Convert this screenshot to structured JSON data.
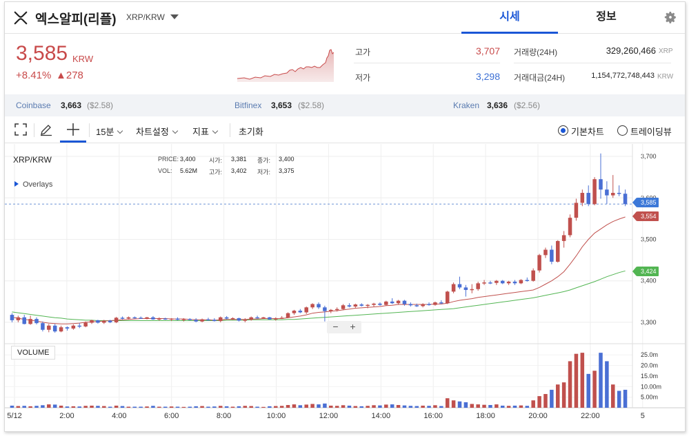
{
  "header": {
    "coin_name": "엑스알피(리플)",
    "pair": "XRP/KRW",
    "tabs": [
      {
        "label": "시세",
        "active": true
      },
      {
        "label": "정보",
        "active": false
      }
    ]
  },
  "summary": {
    "price": "3,585",
    "unit": "KRW",
    "change_pct": "+8.41%",
    "change_abs": "▲278",
    "high_label": "고가",
    "high_value": "3,707",
    "low_label": "저가",
    "low_value": "3,298",
    "volume_label": "거래량(24H)",
    "volume_value": "329,260,466",
    "volume_unit": "XRP",
    "amount_label": "거래대금(24H)",
    "amount_value": "1,154,772,748,443",
    "amount_unit": "KRW"
  },
  "exchanges": [
    {
      "name": "Coinbase",
      "price": "3,663",
      "usd": "($2.58)"
    },
    {
      "name": "Bitfinex",
      "price": "3,653",
      "usd": "($2.58)"
    },
    {
      "name": "Kraken",
      "price": "3,636",
      "usd": "($2.56)"
    }
  ],
  "toolbar": {
    "interval": "15분",
    "chart_settings": "차트설정",
    "indicators": "지표",
    "reset": "초기화",
    "mode_basic": "기본차트",
    "mode_trading": "트레이딩뷰"
  },
  "chart": {
    "pair_label": "XRP/KRW",
    "overlays_label": "Overlays",
    "volume_label": "VOLUME",
    "ohlc": {
      "price_label": "PRICE:",
      "price": "3,400",
      "open_label": "시가:",
      "open": "3,381",
      "close_label": "종가:",
      "close": "3,400",
      "vol_label": "VOL:",
      "vol": "5.62M",
      "high_label": "고가:",
      "high": "3,402",
      "low_label": "저가:",
      "low": "3,375"
    },
    "zoom_out": "−",
    "zoom_in": "+",
    "tags": {
      "current": "3,585",
      "ma_short": "3,554",
      "ma_long": "3,424"
    }
  },
  "chart_data": {
    "type": "candlestick",
    "x_tick_labels": [
      "5/12",
      "2:00",
      "4:00",
      "6:00",
      "8:00",
      "10:00",
      "12:00",
      "14:00",
      "16:00",
      "18:00",
      "20:00",
      "22:00",
      "5"
    ],
    "y_tick_labels": [
      "3,700",
      "3,600",
      "3,500",
      "3,400",
      "3,300"
    ],
    "ylim": [
      3270,
      3710
    ],
    "volume_tick_labels": [
      "25.0m",
      "20.0m",
      "15.0m",
      "10.00m",
      "5.00m"
    ],
    "volume_ylim": [
      0,
      28
    ],
    "grid": true,
    "current_price": 3585,
    "colors": {
      "up": "#c0504d",
      "down": "#4a6fd4",
      "ma_short": "#c0504d",
      "ma_long": "#52b552"
    },
    "candles": [
      {
        "o": 3318,
        "h": 3322,
        "l": 3300,
        "c": 3305,
        "v": 1.0
      },
      {
        "o": 3305,
        "h": 3316,
        "l": 3300,
        "c": 3312,
        "v": 0.8
      },
      {
        "o": 3312,
        "h": 3318,
        "l": 3295,
        "c": 3296,
        "v": 0.9
      },
      {
        "o": 3296,
        "h": 3316,
        "l": 3294,
        "c": 3308,
        "v": 0.7
      },
      {
        "o": 3308,
        "h": 3312,
        "l": 3295,
        "c": 3298,
        "v": 0.9
      },
      {
        "o": 3298,
        "h": 3302,
        "l": 3278,
        "c": 3282,
        "v": 1.2
      },
      {
        "o": 3282,
        "h": 3296,
        "l": 3276,
        "c": 3292,
        "v": 1.6
      },
      {
        "o": 3292,
        "h": 3296,
        "l": 3275,
        "c": 3278,
        "v": 1.5
      },
      {
        "o": 3278,
        "h": 3292,
        "l": 3276,
        "c": 3288,
        "v": 1.0
      },
      {
        "o": 3288,
        "h": 3290,
        "l": 3280,
        "c": 3285,
        "v": 0.6
      },
      {
        "o": 3285,
        "h": 3295,
        "l": 3282,
        "c": 3292,
        "v": 0.7
      },
      {
        "o": 3292,
        "h": 3298,
        "l": 3286,
        "c": 3290,
        "v": 0.6
      },
      {
        "o": 3290,
        "h": 3302,
        "l": 3288,
        "c": 3299,
        "v": 0.9
      },
      {
        "o": 3299,
        "h": 3306,
        "l": 3296,
        "c": 3305,
        "v": 1.0
      },
      {
        "o": 3305,
        "h": 3306,
        "l": 3297,
        "c": 3299,
        "v": 0.9
      },
      {
        "o": 3299,
        "h": 3306,
        "l": 3296,
        "c": 3304,
        "v": 0.8
      },
      {
        "o": 3304,
        "h": 3306,
        "l": 3298,
        "c": 3300,
        "v": 0.5
      },
      {
        "o": 3300,
        "h": 3313,
        "l": 3298,
        "c": 3311,
        "v": 1.0
      },
      {
        "o": 3311,
        "h": 3314,
        "l": 3307,
        "c": 3309,
        "v": 0.8
      },
      {
        "o": 3309,
        "h": 3314,
        "l": 3307,
        "c": 3312,
        "v": 0.5
      },
      {
        "o": 3312,
        "h": 3314,
        "l": 3309,
        "c": 3311,
        "v": 0.5
      },
      {
        "o": 3311,
        "h": 3314,
        "l": 3309,
        "c": 3310,
        "v": 0.5
      },
      {
        "o": 3310,
        "h": 3313,
        "l": 3307,
        "c": 3312,
        "v": 0.6
      },
      {
        "o": 3312,
        "h": 3315,
        "l": 3306,
        "c": 3307,
        "v": 0.9
      },
      {
        "o": 3307,
        "h": 3312,
        "l": 3304,
        "c": 3309,
        "v": 0.5
      },
      {
        "o": 3309,
        "h": 3311,
        "l": 3306,
        "c": 3307,
        "v": 0.5
      },
      {
        "o": 3307,
        "h": 3310,
        "l": 3303,
        "c": 3309,
        "v": 0.6
      },
      {
        "o": 3309,
        "h": 3312,
        "l": 3305,
        "c": 3306,
        "v": 0.5
      },
      {
        "o": 3306,
        "h": 3310,
        "l": 3302,
        "c": 3308,
        "v": 0.4
      },
      {
        "o": 3308,
        "h": 3310,
        "l": 3305,
        "c": 3306,
        "v": 0.5
      },
      {
        "o": 3306,
        "h": 3310,
        "l": 3300,
        "c": 3302,
        "v": 0.7
      },
      {
        "o": 3302,
        "h": 3309,
        "l": 3300,
        "c": 3307,
        "v": 0.8
      },
      {
        "o": 3307,
        "h": 3311,
        "l": 3304,
        "c": 3306,
        "v": 0.5
      },
      {
        "o": 3306,
        "h": 3310,
        "l": 3302,
        "c": 3303,
        "v": 0.6
      },
      {
        "o": 3303,
        "h": 3314,
        "l": 3300,
        "c": 3312,
        "v": 0.9
      },
      {
        "o": 3312,
        "h": 3315,
        "l": 3307,
        "c": 3309,
        "v": 0.7
      },
      {
        "o": 3309,
        "h": 3312,
        "l": 3306,
        "c": 3310,
        "v": 0.5
      },
      {
        "o": 3310,
        "h": 3311,
        "l": 3302,
        "c": 3304,
        "v": 0.7
      },
      {
        "o": 3304,
        "h": 3310,
        "l": 3300,
        "c": 3306,
        "v": 0.9
      },
      {
        "o": 3306,
        "h": 3314,
        "l": 3304,
        "c": 3312,
        "v": 0.8
      },
      {
        "o": 3312,
        "h": 3316,
        "l": 3309,
        "c": 3311,
        "v": 0.5
      },
      {
        "o": 3311,
        "h": 3313,
        "l": 3308,
        "c": 3312,
        "v": 0.4
      },
      {
        "o": 3312,
        "h": 3313,
        "l": 3306,
        "c": 3307,
        "v": 0.7
      },
      {
        "o": 3307,
        "h": 3312,
        "l": 3304,
        "c": 3310,
        "v": 0.8
      },
      {
        "o": 3310,
        "h": 3315,
        "l": 3308,
        "c": 3311,
        "v": 0.9
      },
      {
        "o": 3311,
        "h": 3324,
        "l": 3310,
        "c": 3322,
        "v": 1.3
      },
      {
        "o": 3322,
        "h": 3330,
        "l": 3318,
        "c": 3328,
        "v": 1.6
      },
      {
        "o": 3328,
        "h": 3332,
        "l": 3322,
        "c": 3324,
        "v": 1.2
      },
      {
        "o": 3324,
        "h": 3338,
        "l": 3320,
        "c": 3336,
        "v": 1.5
      },
      {
        "o": 3336,
        "h": 3346,
        "l": 3332,
        "c": 3344,
        "v": 1.8
      },
      {
        "o": 3344,
        "h": 3348,
        "l": 3332,
        "c": 3336,
        "v": 1.6
      },
      {
        "o": 3336,
        "h": 3340,
        "l": 3302,
        "c": 3327,
        "v": 2.0
      },
      {
        "o": 3327,
        "h": 3332,
        "l": 3322,
        "c": 3330,
        "v": 1.0
      },
      {
        "o": 3330,
        "h": 3336,
        "l": 3326,
        "c": 3332,
        "v": 0.9
      },
      {
        "o": 3332,
        "h": 3344,
        "l": 3329,
        "c": 3341,
        "v": 1.2
      },
      {
        "o": 3341,
        "h": 3346,
        "l": 3336,
        "c": 3338,
        "v": 1.0
      },
      {
        "o": 3338,
        "h": 3345,
        "l": 3335,
        "c": 3343,
        "v": 0.8
      },
      {
        "o": 3343,
        "h": 3346,
        "l": 3338,
        "c": 3340,
        "v": 0.7
      },
      {
        "o": 3340,
        "h": 3344,
        "l": 3334,
        "c": 3342,
        "v": 0.9
      },
      {
        "o": 3342,
        "h": 3347,
        "l": 3338,
        "c": 3345,
        "v": 1.2
      },
      {
        "o": 3345,
        "h": 3348,
        "l": 3340,
        "c": 3342,
        "v": 1.1
      },
      {
        "o": 3342,
        "h": 3352,
        "l": 3340,
        "c": 3350,
        "v": 1.5
      },
      {
        "o": 3350,
        "h": 3358,
        "l": 3344,
        "c": 3346,
        "v": 1.6
      },
      {
        "o": 3346,
        "h": 3354,
        "l": 3342,
        "c": 3352,
        "v": 1.3
      },
      {
        "o": 3352,
        "h": 3354,
        "l": 3340,
        "c": 3344,
        "v": 1.1
      },
      {
        "o": 3344,
        "h": 3348,
        "l": 3338,
        "c": 3341,
        "v": 0.9
      },
      {
        "o": 3341,
        "h": 3345,
        "l": 3337,
        "c": 3339,
        "v": 0.8
      },
      {
        "o": 3339,
        "h": 3346,
        "l": 3336,
        "c": 3344,
        "v": 1.0
      },
      {
        "o": 3344,
        "h": 3348,
        "l": 3340,
        "c": 3342,
        "v": 0.9
      },
      {
        "o": 3342,
        "h": 3350,
        "l": 3340,
        "c": 3348,
        "v": 1.2
      },
      {
        "o": 3348,
        "h": 3353,
        "l": 3344,
        "c": 3346,
        "v": 0.8
      },
      {
        "o": 3346,
        "h": 3376,
        "l": 3344,
        "c": 3374,
        "v": 4.5
      },
      {
        "o": 3374,
        "h": 3396,
        "l": 3370,
        "c": 3392,
        "v": 3.5
      },
      {
        "o": 3392,
        "h": 3410,
        "l": 3380,
        "c": 3384,
        "v": 3.0
      },
      {
        "o": 3384,
        "h": 3390,
        "l": 3362,
        "c": 3378,
        "v": 2.6
      },
      {
        "o": 3378,
        "h": 3392,
        "l": 3370,
        "c": 3380,
        "v": 1.8
      },
      {
        "o": 3380,
        "h": 3398,
        "l": 3376,
        "c": 3394,
        "v": 1.6
      },
      {
        "o": 3394,
        "h": 3402,
        "l": 3390,
        "c": 3396,
        "v": 1.4
      },
      {
        "o": 3396,
        "h": 3400,
        "l": 3392,
        "c": 3395,
        "v": 1.3
      },
      {
        "o": 3395,
        "h": 3402,
        "l": 3390,
        "c": 3400,
        "v": 1.6
      },
      {
        "o": 3400,
        "h": 3402,
        "l": 3392,
        "c": 3394,
        "v": 1.0
      },
      {
        "o": 3394,
        "h": 3400,
        "l": 3390,
        "c": 3398,
        "v": 0.9
      },
      {
        "o": 3398,
        "h": 3402,
        "l": 3390,
        "c": 3394,
        "v": 1.0
      },
      {
        "o": 3394,
        "h": 3404,
        "l": 3392,
        "c": 3402,
        "v": 1.1
      },
      {
        "o": 3402,
        "h": 3408,
        "l": 3398,
        "c": 3400,
        "v": 0.9
      },
      {
        "o": 3400,
        "h": 3430,
        "l": 3398,
        "c": 3425,
        "v": 3.5
      },
      {
        "o": 3425,
        "h": 3465,
        "l": 3420,
        "c": 3462,
        "v": 5.5
      },
      {
        "o": 3462,
        "h": 3480,
        "l": 3455,
        "c": 3475,
        "v": 6.5
      },
      {
        "o": 3475,
        "h": 3485,
        "l": 3440,
        "c": 3446,
        "v": 8.5
      },
      {
        "o": 3446,
        "h": 3498,
        "l": 3444,
        "c": 3496,
        "v": 11.0
      },
      {
        "o": 3496,
        "h": 3520,
        "l": 3480,
        "c": 3510,
        "v": 12.0
      },
      {
        "o": 3510,
        "h": 3560,
        "l": 3505,
        "c": 3552,
        "v": 22.0
      },
      {
        "o": 3552,
        "h": 3598,
        "l": 3545,
        "c": 3588,
        "v": 25.5
      },
      {
        "o": 3588,
        "h": 3620,
        "l": 3580,
        "c": 3612,
        "v": 26.0
      },
      {
        "o": 3612,
        "h": 3630,
        "l": 3580,
        "c": 3585,
        "v": 16.0
      },
      {
        "o": 3585,
        "h": 3650,
        "l": 3582,
        "c": 3645,
        "v": 17.5
      },
      {
        "o": 3645,
        "h": 3707,
        "l": 3598,
        "c": 3620,
        "v": 26.0
      },
      {
        "o": 3620,
        "h": 3640,
        "l": 3585,
        "c": 3606,
        "v": 22.0
      },
      {
        "o": 3606,
        "h": 3655,
        "l": 3600,
        "c": 3612,
        "v": 11.0
      },
      {
        "o": 3612,
        "h": 3630,
        "l": 3604,
        "c": 3610,
        "v": 8.0
      },
      {
        "o": 3610,
        "h": 3620,
        "l": 3580,
        "c": 3585,
        "v": 8.5
      }
    ],
    "ma_short": [
      3312,
      3310,
      3307,
      3305,
      3303,
      3300,
      3298,
      3297,
      3296,
      3296,
      3297,
      3298,
      3300,
      3301,
      3302,
      3303,
      3304,
      3305,
      3306,
      3307,
      3308,
      3309,
      3309,
      3309,
      3309,
      3309,
      3308,
      3308,
      3308,
      3307,
      3306,
      3306,
      3306,
      3305,
      3306,
      3307,
      3307,
      3307,
      3307,
      3308,
      3308,
      3309,
      3309,
      3309,
      3309,
      3311,
      3313,
      3315,
      3318,
      3322,
      3324,
      3325,
      3327,
      3328,
      3330,
      3332,
      3334,
      3335,
      3336,
      3337,
      3338,
      3340,
      3341,
      3343,
      3343,
      3343,
      3343,
      3343,
      3343,
      3344,
      3344,
      3346,
      3350,
      3353,
      3355,
      3357,
      3360,
      3362,
      3364,
      3366,
      3368,
      3370,
      3372,
      3374,
      3376,
      3378,
      3384,
      3392,
      3400,
      3410,
      3422,
      3440,
      3460,
      3482,
      3500,
      3515,
      3525,
      3535,
      3543,
      3549,
      3554
    ],
    "ma_long": [
      3325,
      3323,
      3321,
      3319,
      3317,
      3315,
      3313,
      3311,
      3310,
      3308,
      3307,
      3306,
      3305,
      3305,
      3304,
      3304,
      3304,
      3304,
      3304,
      3304,
      3304,
      3304,
      3304,
      3304,
      3304,
      3304,
      3304,
      3304,
      3304,
      3304,
      3304,
      3304,
      3304,
      3304,
      3304,
      3305,
      3305,
      3305,
      3305,
      3306,
      3306,
      3306,
      3306,
      3306,
      3306,
      3307,
      3307,
      3308,
      3309,
      3310,
      3311,
      3312,
      3313,
      3314,
      3315,
      3316,
      3317,
      3318,
      3319,
      3320,
      3321,
      3322,
      3323,
      3324,
      3325,
      3326,
      3327,
      3328,
      3329,
      3330,
      3331,
      3332,
      3333,
      3335,
      3337,
      3339,
      3341,
      3343,
      3345,
      3347,
      3349,
      3351,
      3353,
      3355,
      3357,
      3359,
      3362,
      3365,
      3368,
      3371,
      3374,
      3378,
      3383,
      3388,
      3393,
      3398,
      3404,
      3410,
      3415,
      3420,
      3424
    ]
  }
}
